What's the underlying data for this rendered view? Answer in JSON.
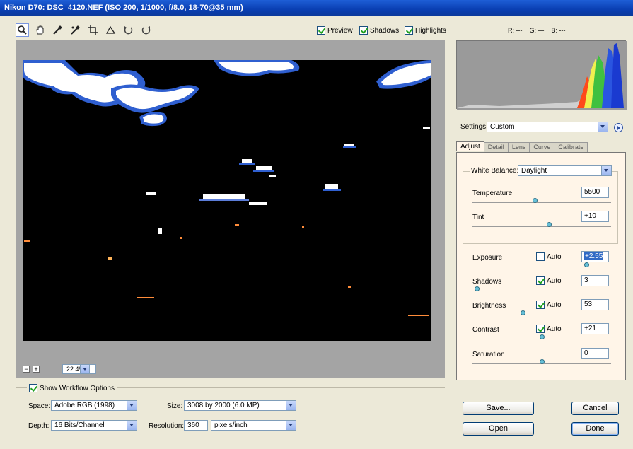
{
  "window": {
    "title": "Nikon D70:  DSC_4120.NEF  (ISO 200, 1/1000, f/8.0, 18-70@35 mm)"
  },
  "toolbar": {
    "tools": [
      {
        "icon": "zoom-icon"
      },
      {
        "icon": "hand-icon"
      },
      {
        "icon": "white-balance-eyedropper-icon"
      },
      {
        "icon": "color-sampler-icon"
      },
      {
        "icon": "crop-icon"
      },
      {
        "icon": "straighten-icon"
      },
      {
        "icon": "rotate-left-icon"
      },
      {
        "icon": "rotate-right-icon"
      }
    ],
    "preview_label": "Preview",
    "shadows_label": "Shadows",
    "highlights_label": "Highlights"
  },
  "readout": {
    "r": "R: ---",
    "g": "G: ---",
    "b": "B: ---"
  },
  "zoom": {
    "minus": "−",
    "plus": "+",
    "value": "22.4%"
  },
  "settings": {
    "label": "Settings:",
    "value": "Custom"
  },
  "tabs": [
    "Adjust",
    "Detail",
    "Lens",
    "Curve",
    "Calibrate"
  ],
  "adjust": {
    "white_balance_label": "White Balance:",
    "white_balance_value": "Daylight",
    "temperature": {
      "label": "Temperature",
      "value": "5500",
      "level": 0.45
    },
    "tint": {
      "label": "Tint",
      "value": "+10",
      "level": 0.55
    },
    "exposure": {
      "label": "Exposure",
      "auto_label": "Auto",
      "auto": false,
      "value": "+2.55",
      "level": 0.82
    },
    "shadows": {
      "label": "Shadows",
      "auto_label": "Auto",
      "auto": true,
      "value": "3",
      "level": 0.03
    },
    "brightness": {
      "label": "Brightness",
      "auto_label": "Auto",
      "auto": true,
      "value": "53",
      "level": 0.36
    },
    "contrast": {
      "label": "Contrast",
      "auto_label": "Auto",
      "auto": true,
      "value": "+21",
      "level": 0.5
    },
    "saturation": {
      "label": "Saturation",
      "value": "0",
      "level": 0.5
    }
  },
  "workflow": {
    "show_label": "Show Workflow Options",
    "space_label": "Space:",
    "space_value": "Adobe RGB (1998)",
    "depth_label": "Depth:",
    "depth_value": "16 Bits/Channel",
    "size_label": "Size:",
    "size_value": "3008 by 2000  (6.0 MP)",
    "resolution_label": "Resolution:",
    "resolution_value": "360",
    "resolution_unit": "pixels/inch"
  },
  "buttons": {
    "save": "Save...",
    "cancel": "Cancel",
    "open": "Open",
    "done": "Done"
  }
}
